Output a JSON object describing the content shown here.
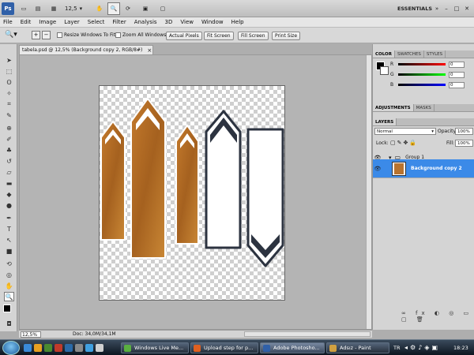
{
  "topbar": {
    "zoom_value": "12,5",
    "workspace": "ESSENTIALS"
  },
  "menu": [
    "File",
    "Edit",
    "Image",
    "Layer",
    "Select",
    "Filter",
    "Analysis",
    "3D",
    "View",
    "Window",
    "Help"
  ],
  "options": {
    "resize_windows": "Resize Windows To Fit",
    "zoom_all": "Zoom All Windows",
    "actual_pixels": "Actual Pixels",
    "fit_screen": "Fit Screen",
    "fill_screen": "Fill Screen",
    "print_size": "Print Size"
  },
  "document": {
    "tab_title": "tabela.psd @ 12,5% (Background copy 2, RGB/8#)",
    "zoom": "12,5%",
    "doc_info": "Doc: 34,0M/34,1M"
  },
  "color_panel": {
    "tabs": [
      "COLOR",
      "SWATCHES",
      "STYLES"
    ],
    "channels": [
      {
        "label": "R",
        "value": "0",
        "color": "#d02020"
      },
      {
        "label": "G",
        "value": "0",
        "color": "#20a020"
      },
      {
        "label": "B",
        "value": "0",
        "color": "#2030d0"
      }
    ]
  },
  "adjust_panel": {
    "tabs": [
      "ADJUSTMENTS",
      "MASKS"
    ]
  },
  "layers_panel": {
    "tab": "LAYERS",
    "blend_mode": "Normal",
    "opacity_label": "Opacity:",
    "opacity": "100%",
    "lock_label": "Lock:",
    "fill_label": "Fill:",
    "fill": "100%",
    "layers": [
      {
        "name": "Group 1",
        "selected": false
      },
      {
        "name": "Background copy 2",
        "selected": true
      }
    ]
  },
  "taskbar": {
    "items": [
      "Windows Live Me...",
      "Upload step for p...",
      "Adobe Photosho...",
      "Adsız - Paint"
    ],
    "lang": "TR",
    "time": "18:23"
  },
  "colors": {
    "brown": "#b8732e",
    "dark": "#2c3340",
    "selection": "#3b8ae8"
  }
}
